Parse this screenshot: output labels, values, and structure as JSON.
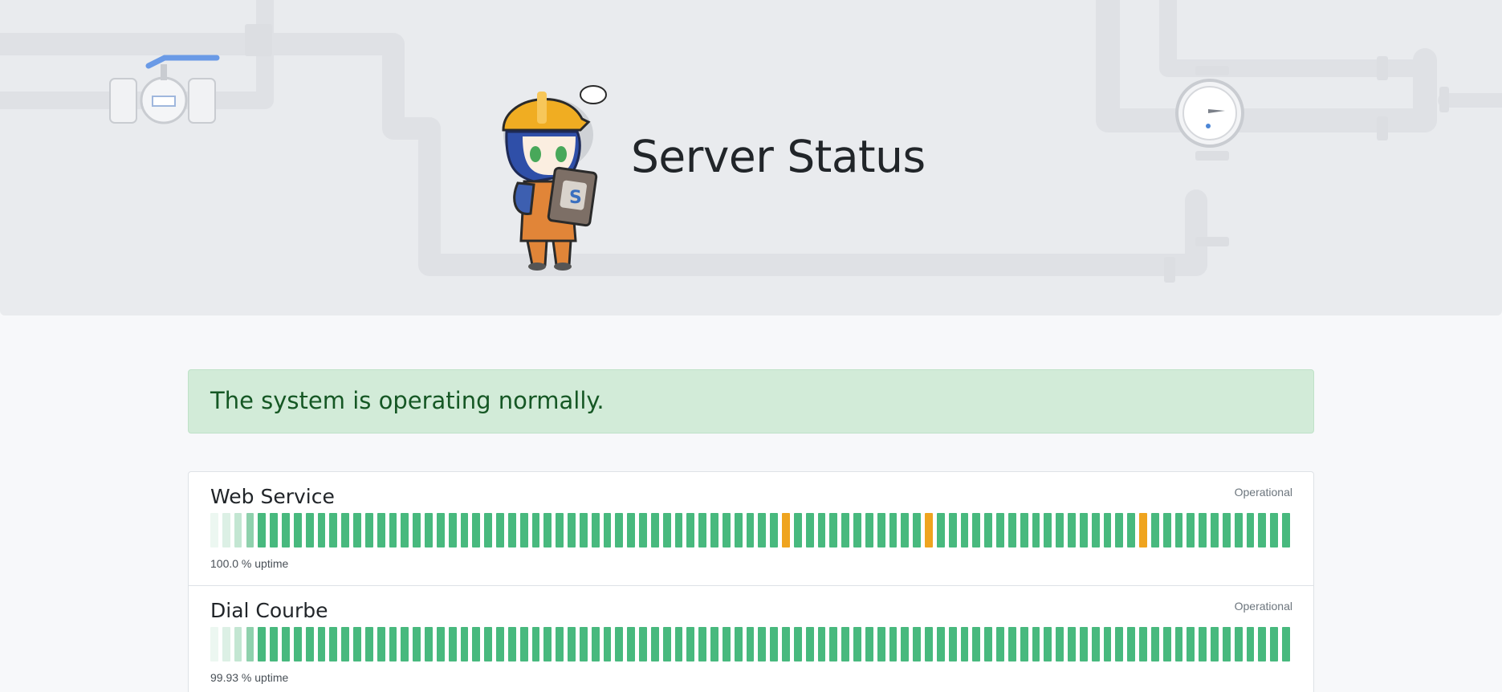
{
  "header": {
    "title": "Server Status",
    "mascot_icon": "mascot-worker-with-clipboard-icon",
    "mascot_badge": "S"
  },
  "alert": {
    "text": "The system is operating normally.",
    "color": "#155724",
    "background": "#d2ebd8"
  },
  "colors": {
    "up": "#48b97e",
    "degraded": "#efa41f",
    "faded": [
      "#ecf7f1",
      "#dcf0e5",
      "#c3e6d2",
      "#8fd1ad"
    ]
  },
  "monitors": [
    {
      "name": "Web Service",
      "status": "Operational",
      "uptime": "100.0 % uptime",
      "bars": [
        "f0",
        "f1",
        "f2",
        "f3",
        "u",
        "u",
        "u",
        "u",
        "u",
        "u",
        "u",
        "u",
        "u",
        "u",
        "u",
        "u",
        "u",
        "u",
        "u",
        "u",
        "u",
        "u",
        "u",
        "u",
        "u",
        "u",
        "u",
        "u",
        "u",
        "u",
        "u",
        "u",
        "u",
        "u",
        "u",
        "u",
        "u",
        "u",
        "u",
        "u",
        "u",
        "u",
        "u",
        "u",
        "u",
        "u",
        "u",
        "u",
        "d",
        "u",
        "u",
        "u",
        "u",
        "u",
        "u",
        "u",
        "u",
        "u",
        "u",
        "u",
        "d",
        "u",
        "u",
        "u",
        "u",
        "u",
        "u",
        "u",
        "u",
        "u",
        "u",
        "u",
        "u",
        "u",
        "u",
        "u",
        "u",
        "u",
        "d",
        "u",
        "u",
        "u",
        "u",
        "u",
        "u",
        "u",
        "u",
        "u",
        "u",
        "u",
        "u"
      ]
    },
    {
      "name": "Dial Courbe",
      "status": "Operational",
      "uptime": "99.93 % uptime",
      "bars": [
        "f0",
        "f1",
        "f2",
        "f3",
        "u",
        "u",
        "u",
        "u",
        "u",
        "u",
        "u",
        "u",
        "u",
        "u",
        "u",
        "u",
        "u",
        "u",
        "u",
        "u",
        "u",
        "u",
        "u",
        "u",
        "u",
        "u",
        "u",
        "u",
        "u",
        "u",
        "u",
        "u",
        "u",
        "u",
        "u",
        "u",
        "u",
        "u",
        "u",
        "u",
        "u",
        "u",
        "u",
        "u",
        "u",
        "u",
        "u",
        "u",
        "u",
        "u",
        "u",
        "u",
        "u",
        "u",
        "u",
        "u",
        "u",
        "u",
        "u",
        "u",
        "u",
        "u",
        "u",
        "u",
        "u",
        "u",
        "u",
        "u",
        "u",
        "u",
        "u",
        "u",
        "u",
        "u",
        "u",
        "u",
        "u",
        "u",
        "u",
        "u",
        "u",
        "u",
        "u",
        "u",
        "u",
        "u",
        "u",
        "u",
        "u",
        "u",
        "u"
      ]
    }
  ]
}
